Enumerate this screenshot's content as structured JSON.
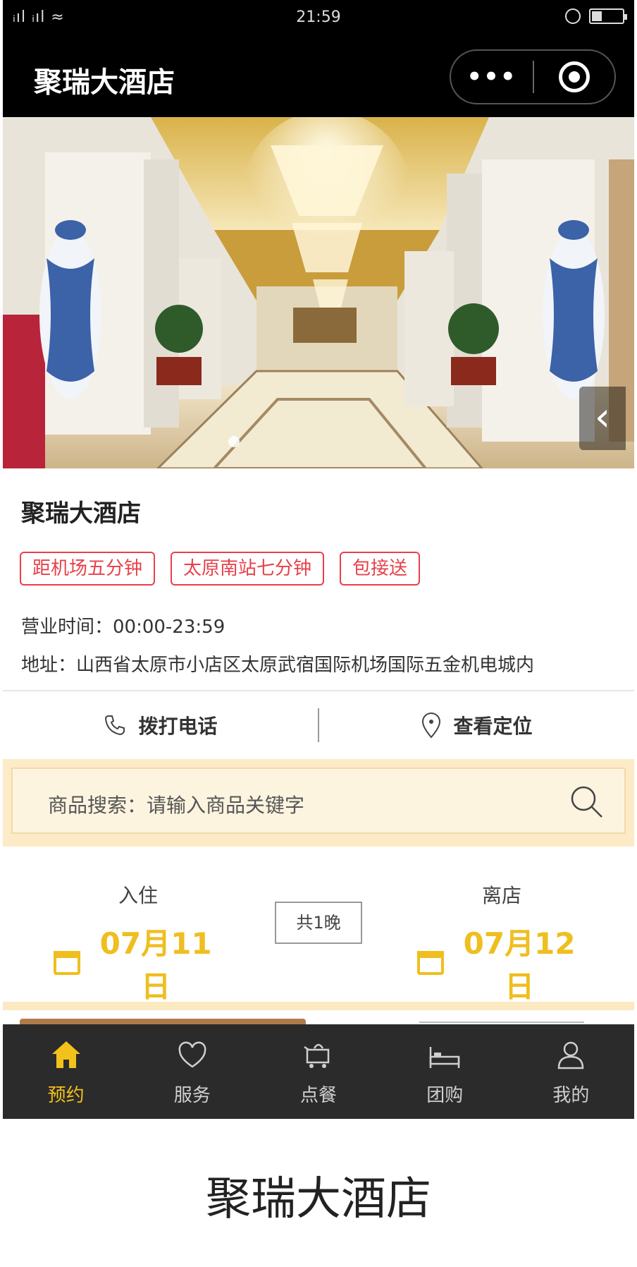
{
  "status_bar": {
    "signal": "ᵢıl ᵢıl ≈",
    "time": "21:59"
  },
  "header": {
    "title": "聚瑞大酒店",
    "more_dots": "•••"
  },
  "hotel": {
    "name": "聚瑞大酒店",
    "tags": [
      "距机场五分钟",
      "太原南站七分钟",
      "包接送"
    ],
    "hours": "营业时间：00:00-23:59",
    "address": "地址：山西省太原市小店区太原武宿国际机场国际五金机电城内"
  },
  "actions": {
    "call": "拨打电话",
    "location": "查看定位"
  },
  "search": {
    "placeholder": "商品搜索：请输入商品关键字"
  },
  "booking": {
    "checkin_label": "入住",
    "checkin_date": "07月11日",
    "checkout_label": "离店",
    "checkout_date": "07月12日",
    "nights": "共1晚"
  },
  "tabs": [
    {
      "label": "预约",
      "icon": "home-icon",
      "active": true
    },
    {
      "label": "服务",
      "icon": "heart-icon",
      "active": false
    },
    {
      "label": "点餐",
      "icon": "cart-icon",
      "active": false
    },
    {
      "label": "团购",
      "icon": "bed-icon",
      "active": false
    },
    {
      "label": "我的",
      "icon": "user-icon",
      "active": false
    }
  ],
  "footer": {
    "caption": "聚瑞大酒店"
  },
  "colors": {
    "accent": "#efbe1f",
    "tag_red": "#e8404a",
    "search_bg": "#fcebc6",
    "tabbar_bg": "#2b2b2b"
  }
}
